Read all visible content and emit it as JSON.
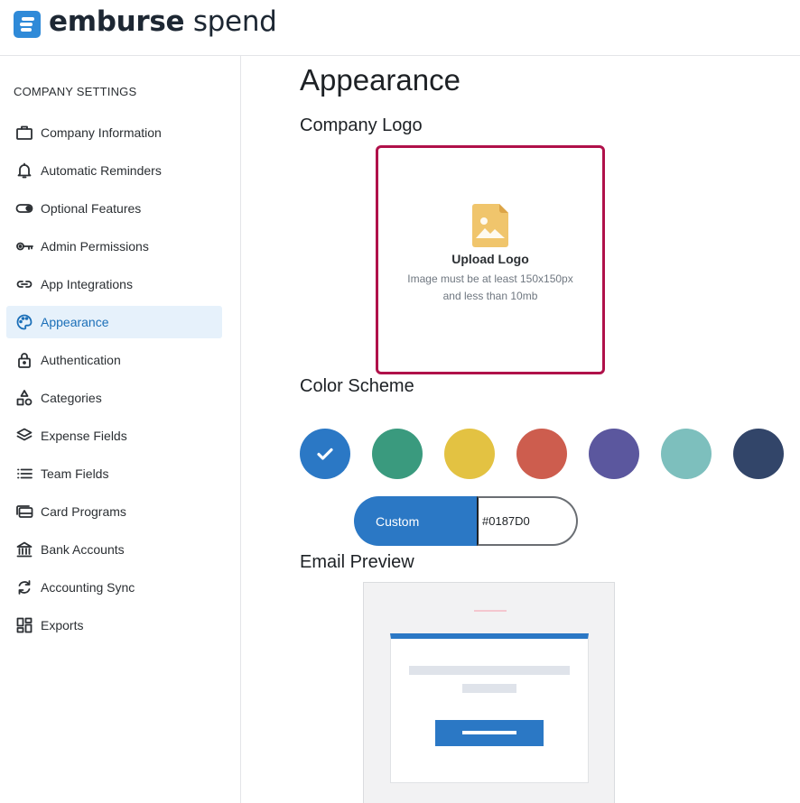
{
  "app": {
    "brand_bold": "emburse",
    "brand_light": " spend"
  },
  "sidebar": {
    "title": "COMPANY SETTINGS",
    "items": [
      {
        "label": "Company Information",
        "icon": "briefcase-icon",
        "active": false
      },
      {
        "label": "Automatic Reminders",
        "icon": "bell-icon",
        "active": false
      },
      {
        "label": "Optional Features",
        "icon": "toggle-icon",
        "active": false
      },
      {
        "label": "Admin Permissions",
        "icon": "key-icon",
        "active": false
      },
      {
        "label": "App Integrations",
        "icon": "link-icon",
        "active": false
      },
      {
        "label": "Appearance",
        "icon": "palette-icon",
        "active": true
      },
      {
        "label": "Authentication",
        "icon": "lock-icon",
        "active": false
      },
      {
        "label": "Categories",
        "icon": "shapes-icon",
        "active": false
      },
      {
        "label": "Expense Fields",
        "icon": "layers-icon",
        "active": false
      },
      {
        "label": "Team Fields",
        "icon": "list-icon",
        "active": false
      },
      {
        "label": "Card Programs",
        "icon": "cards-icon",
        "active": false
      },
      {
        "label": "Bank Accounts",
        "icon": "bank-icon",
        "active": false
      },
      {
        "label": "Accounting Sync",
        "icon": "sync-icon",
        "active": false
      },
      {
        "label": "Exports",
        "icon": "grid-icon",
        "active": false
      }
    ]
  },
  "main": {
    "title": "Appearance",
    "logo_section": {
      "title": "Company Logo",
      "upload_title": "Upload Logo",
      "hint_line1": "Image must be at least 150x150px",
      "hint_line2": "and less than 10mb"
    },
    "color_section": {
      "title": "Color Scheme",
      "swatches": [
        {
          "color": "#2b78c5",
          "selected": true
        },
        {
          "color": "#3a9a7e",
          "selected": false
        },
        {
          "color": "#e3c242",
          "selected": false
        },
        {
          "color": "#cd5d4e",
          "selected": false
        },
        {
          "color": "#5b579e",
          "selected": false
        },
        {
          "color": "#7dbfbd",
          "selected": false
        },
        {
          "color": "#324569",
          "selected": false
        }
      ],
      "custom_label": "Custom",
      "custom_value": "#0187D0"
    },
    "email_section": {
      "title": "Email Preview"
    }
  },
  "colors": {
    "accent": "#2b78c5",
    "focus_border": "#b0114a",
    "active_bg": "#e6f1fb"
  }
}
